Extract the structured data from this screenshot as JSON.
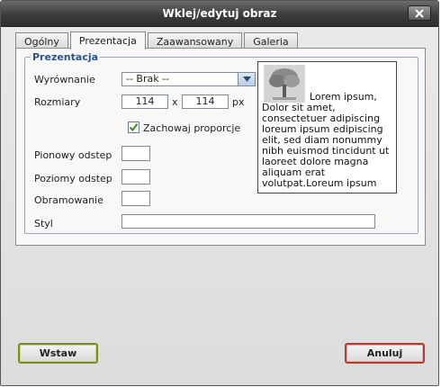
{
  "window": {
    "title": "Wklej/edytuj obraz"
  },
  "tabs": [
    {
      "label": "Ogólny",
      "active": false
    },
    {
      "label": "Prezentacja",
      "active": true
    },
    {
      "label": "Zaawansowany",
      "active": false
    },
    {
      "label": "Galeria",
      "active": false
    }
  ],
  "fieldset": {
    "legend": "Prezentacja"
  },
  "form": {
    "alignment": {
      "label": "Wyrównanie",
      "value": "-- Brak --"
    },
    "dimensions": {
      "label": "Rozmiary",
      "width": "114",
      "separator": "x",
      "height": "114",
      "unit": "px"
    },
    "constrain": {
      "label": "Zachowaj proporcje",
      "checked": true
    },
    "vspace": {
      "label": "Pionowy odstep",
      "value": ""
    },
    "hspace": {
      "label": "Poziomy odstep",
      "value": ""
    },
    "border": {
      "label": "Obramowanie",
      "value": ""
    },
    "style": {
      "label": "Styl",
      "value": ""
    }
  },
  "preview": {
    "text": "Lorem ipsum, Dolor sit amet, consectetuer adipiscing loreum ipsum edipiscing elit, sed diam nonummy nibh euismod tincidunt ut laoreet dolore magna aliquam erat volutpat.Loreum ipsum"
  },
  "buttons": {
    "insert": "Wstaw",
    "cancel": "Anuluj"
  },
  "colors": {
    "titlebar": "#3d3d3d",
    "legend": "#2a5290",
    "insert_border": "#7a8c2c",
    "cancel_border": "#b83a2a",
    "checkmark": "#2e8b1f"
  },
  "icons": [
    "close-icon",
    "dropdown-arrow-icon",
    "checkmark-icon",
    "tree-image-icon"
  ]
}
